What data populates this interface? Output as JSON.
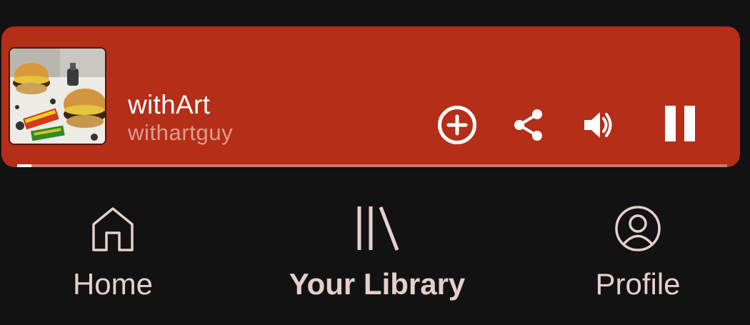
{
  "now_playing": {
    "title": "withArt",
    "artist": "withartguy",
    "artwork_icon": "album-artwork-burgers",
    "progress_fraction": 0.02,
    "accent_color": "#b52e18"
  },
  "controls": {
    "add_icon": "plus-circle-icon",
    "share_icon": "share-icon",
    "volume_icon": "volume-icon",
    "pause_icon": "pause-icon"
  },
  "nav": {
    "active": "Your Library",
    "items": [
      {
        "label": "Home",
        "icon": "home-icon"
      },
      {
        "label": "Your Library",
        "icon": "library-icon"
      },
      {
        "label": "Profile",
        "icon": "profile-icon"
      }
    ]
  }
}
